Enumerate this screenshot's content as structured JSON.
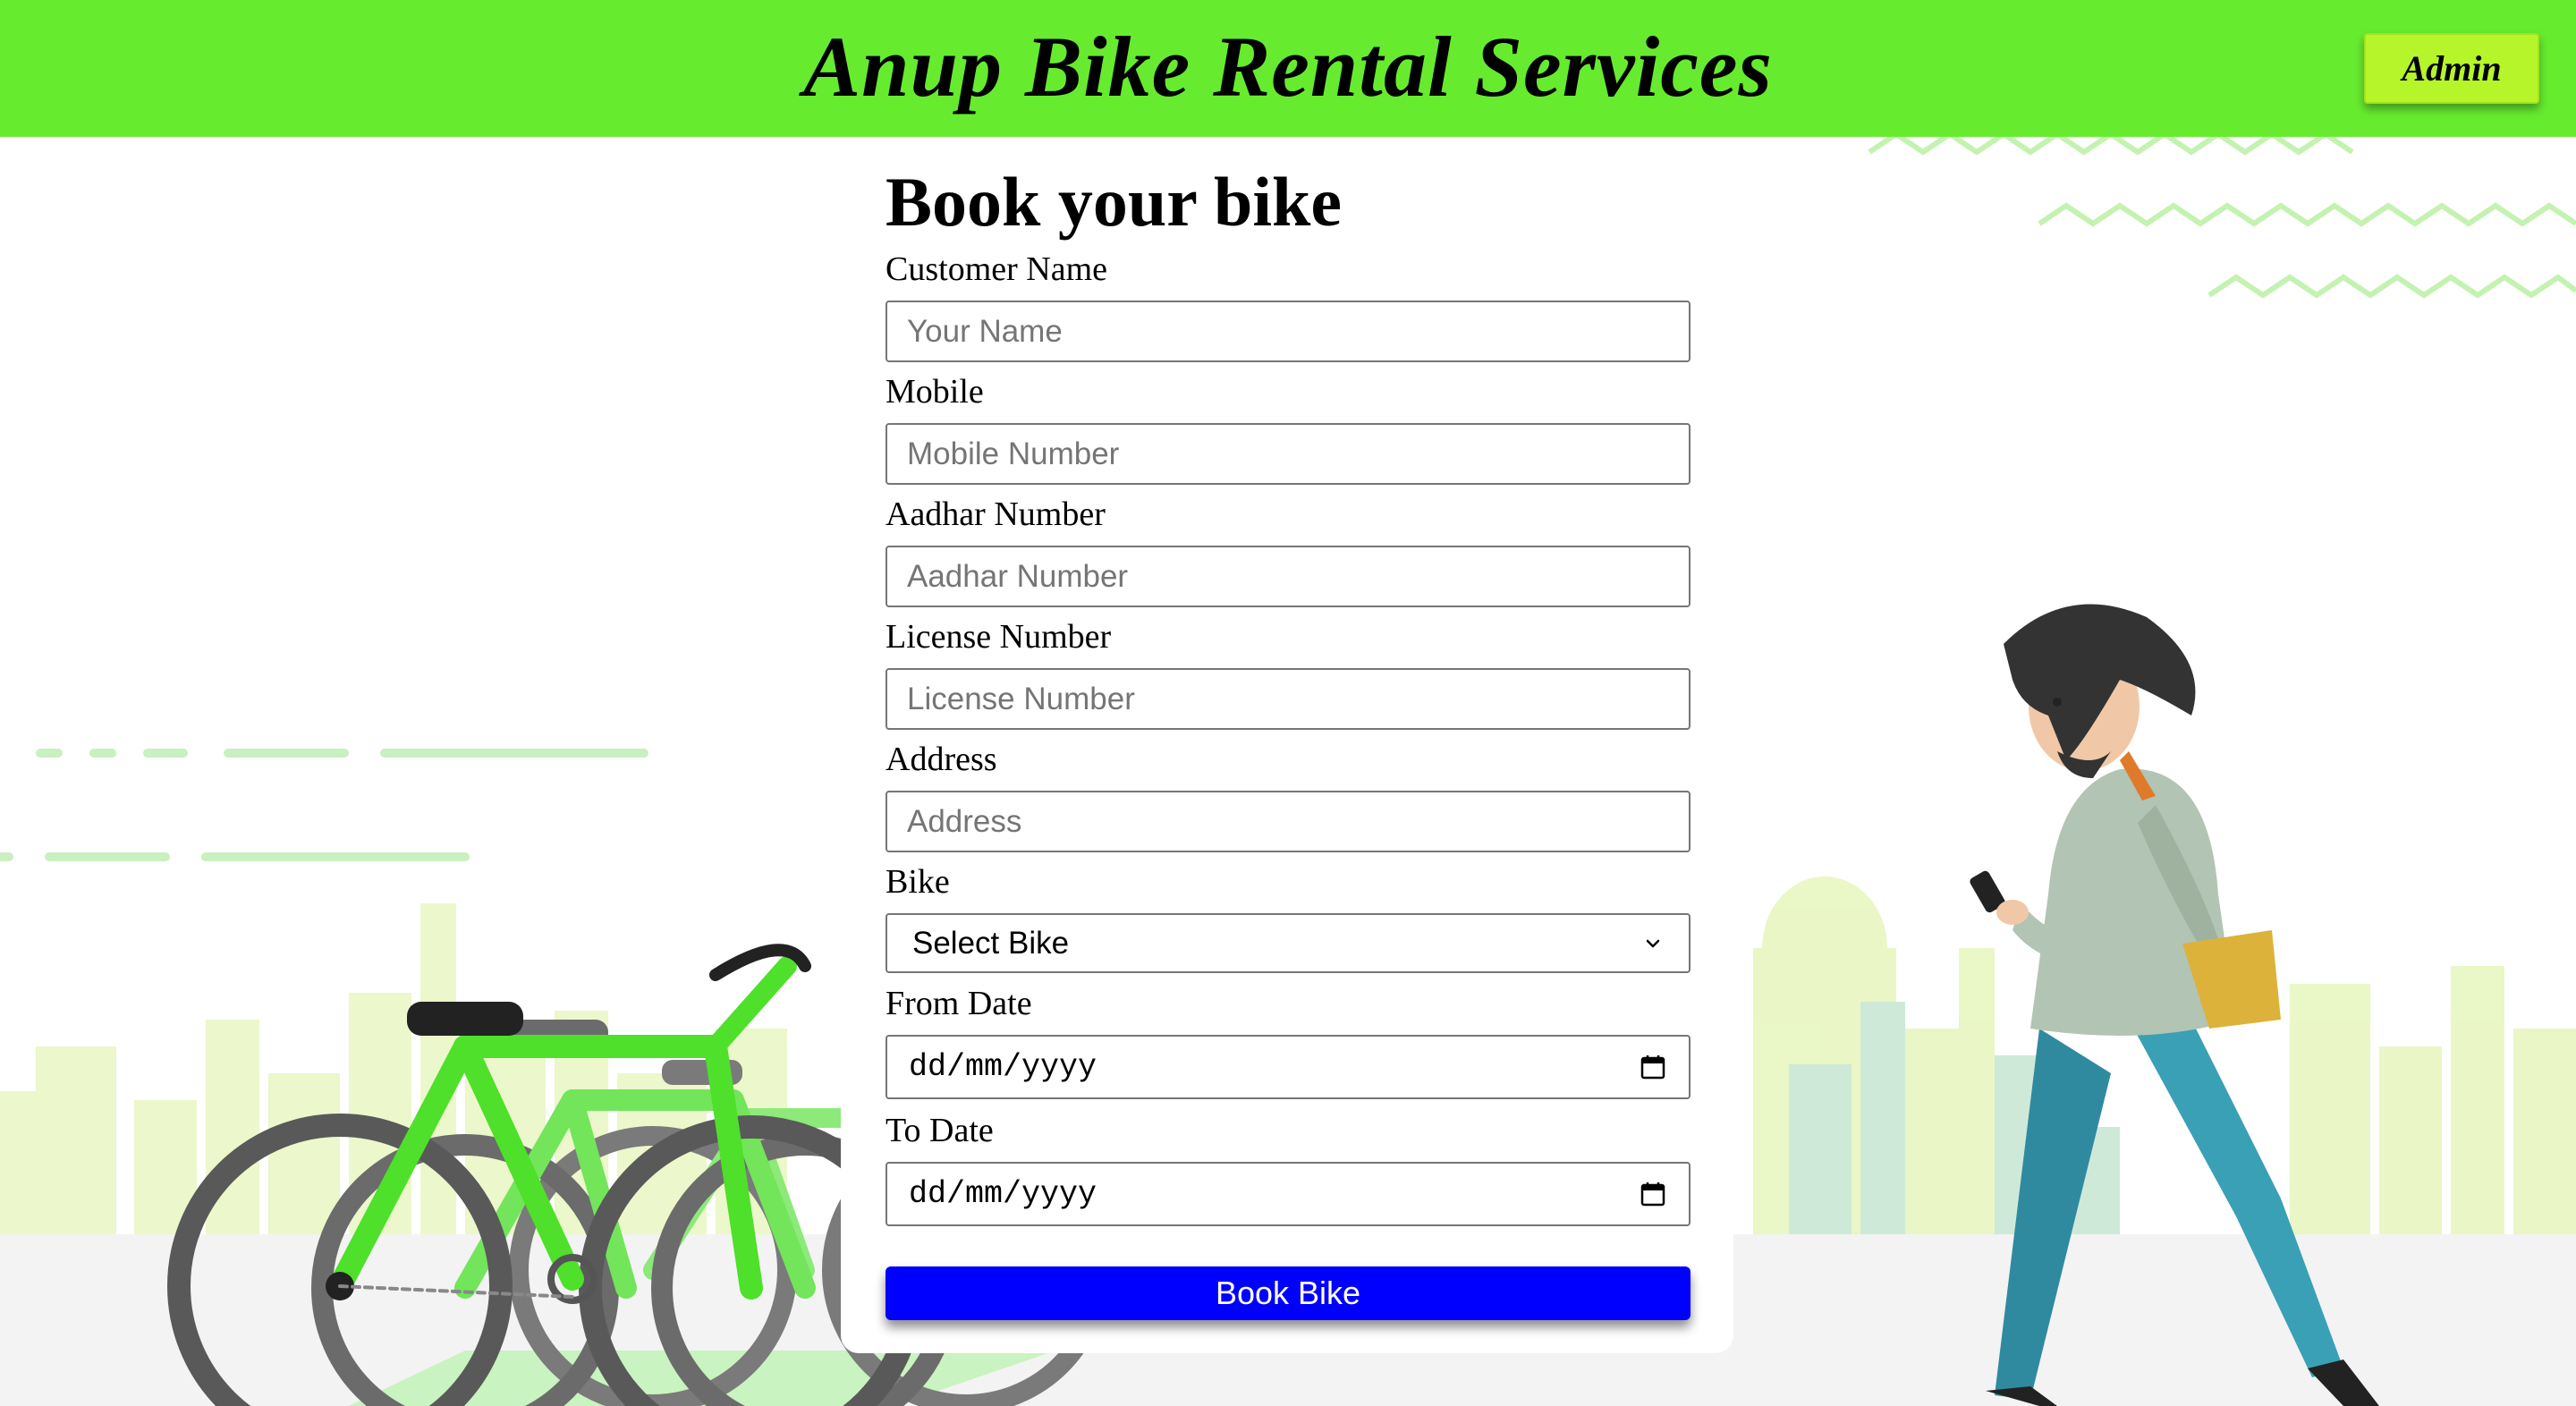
{
  "header": {
    "title": "Anup Bike Rental Services",
    "admin_label": "Admin"
  },
  "form": {
    "title": "Book your bike",
    "fields": {
      "name": {
        "label": "Customer Name",
        "placeholder": "Your Name"
      },
      "mobile": {
        "label": "Mobile",
        "placeholder": "Mobile Number"
      },
      "aadhar": {
        "label": "Aadhar Number",
        "placeholder": "Aadhar Number"
      },
      "license": {
        "label": "License Number",
        "placeholder": "License Number"
      },
      "address": {
        "label": "Address",
        "placeholder": "Address"
      },
      "bike": {
        "label": "Bike",
        "selected": "Select Bike"
      },
      "from_date": {
        "label": "From Date",
        "value": "dd/mm/yyyy"
      },
      "to_date": {
        "label": "To Date",
        "value": "dd/mm/yyyy"
      }
    },
    "submit_label": "Book Bike"
  },
  "icons": {
    "select_arrow": "chevron-down-icon",
    "date_picker": "calendar-icon"
  },
  "colors": {
    "header_bg": "#67eb2f",
    "admin_button_bg": "#b6f52a",
    "submit_button_bg": "#0000fe",
    "bike_green": "#4ee02a",
    "person_pants": "#3aa0b5",
    "bag": "#dcb23a"
  }
}
